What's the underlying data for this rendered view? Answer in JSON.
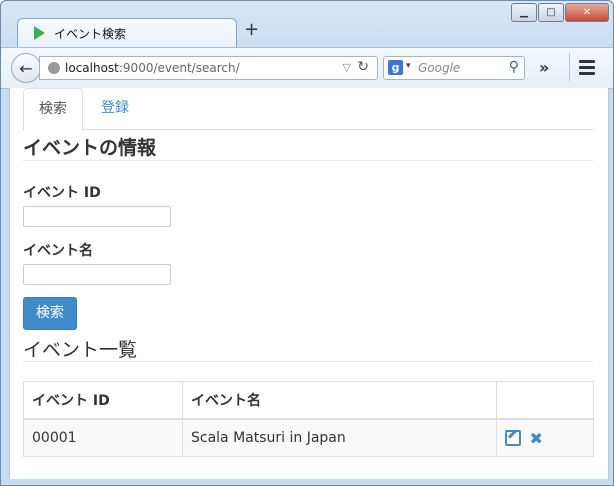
{
  "browser": {
    "tab_title": "イベント検索",
    "new_tab": "+",
    "url_host": "localhost",
    "url_rest": ":9000/event/search/",
    "search_placeholder": "Google",
    "search_engine_icon": "g",
    "overflow": "»"
  },
  "page": {
    "tabs": [
      {
        "label": "検索",
        "active": true
      },
      {
        "label": "登録",
        "active": false
      }
    ],
    "info_heading": "イベントの情報",
    "form": {
      "event_id_label": "イベント ID",
      "event_id_value": "",
      "event_name_label": "イベント名",
      "event_name_value": "",
      "search_button": "検索"
    },
    "list_heading": "イベント一覧",
    "table": {
      "headers": [
        "イベント ID",
        "イベント名",
        ""
      ],
      "rows": [
        {
          "id": "00001",
          "name": "Scala Matsuri in Japan"
        }
      ]
    },
    "colors": {
      "accent": "#428bca"
    }
  }
}
